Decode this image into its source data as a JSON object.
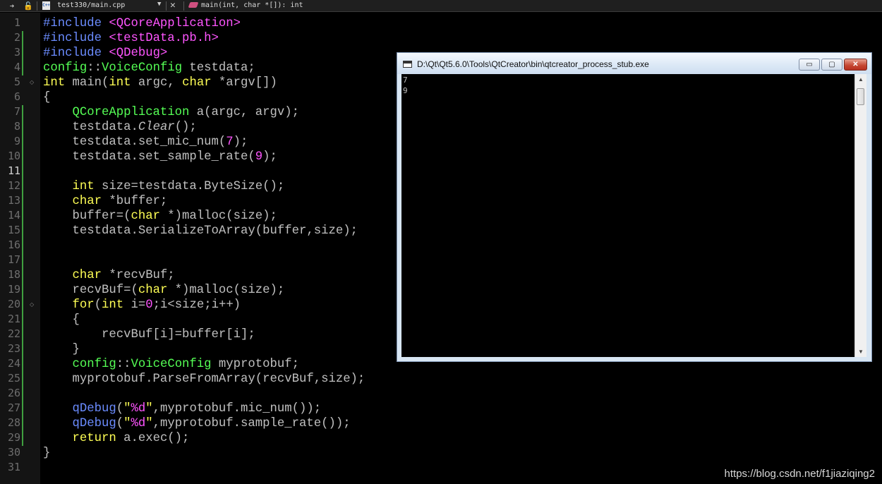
{
  "editor": {
    "document_label": "test330/main.cpp",
    "function_label": "main(int, char *[]): int",
    "current_line": 11,
    "line_numbers": [
      "1",
      "2",
      "3",
      "4",
      "5",
      "6",
      "7",
      "8",
      "9",
      "10",
      "11",
      "12",
      "13",
      "14",
      "15",
      "16",
      "17",
      "18",
      "19",
      "20",
      "21",
      "22",
      "23",
      "24",
      "25",
      "26",
      "27",
      "28",
      "29",
      "30",
      "31"
    ],
    "code": [
      [
        [
          "pp",
          "#include "
        ],
        [
          "inc",
          "<QCoreApplication>"
        ]
      ],
      [
        [
          "pp",
          "#include "
        ],
        [
          "inc",
          "<testData.pb.h>"
        ]
      ],
      [
        [
          "pp",
          "#include "
        ],
        [
          "inc",
          "<QDebug>"
        ]
      ],
      [
        [
          "ty",
          "config"
        ],
        [
          "",
          "::"
        ],
        [
          "ty",
          "VoiceConfig"
        ],
        [
          "",
          " testdata;"
        ]
      ],
      [
        [
          "kw",
          "int"
        ],
        [
          "",
          " main("
        ],
        [
          "kw",
          "int"
        ],
        [
          "",
          " argc, "
        ],
        [
          "kw",
          "char"
        ],
        [
          "",
          " *argv[])"
        ]
      ],
      [
        [
          "",
          "{"
        ]
      ],
      [
        [
          "",
          "    "
        ],
        [
          "ty",
          "QCoreApplication"
        ],
        [
          "",
          " a(argc, argv);"
        ]
      ],
      [
        [
          "",
          "    testdata."
        ],
        [
          "it",
          "Clear"
        ],
        [
          "",
          "();"
        ]
      ],
      [
        [
          "",
          "    testdata.set_mic_num("
        ],
        [
          "num",
          "7"
        ],
        [
          "",
          ");"
        ]
      ],
      [
        [
          "",
          "    testdata.set_sample_rate("
        ],
        [
          "num",
          "9"
        ],
        [
          "",
          ");"
        ]
      ],
      [
        [
          "",
          ""
        ]
      ],
      [
        [
          "",
          "    "
        ],
        [
          "kw",
          "int"
        ],
        [
          "",
          " size=testdata.ByteSize();"
        ]
      ],
      [
        [
          "",
          "    "
        ],
        [
          "kw",
          "char"
        ],
        [
          "",
          " *buffer;"
        ]
      ],
      [
        [
          "",
          "    buffer=("
        ],
        [
          "kw",
          "char"
        ],
        [
          "",
          " *)malloc(size);"
        ]
      ],
      [
        [
          "",
          "    testdata.SerializeToArray(buffer,size);"
        ]
      ],
      [
        [
          "",
          ""
        ]
      ],
      [
        [
          "",
          ""
        ]
      ],
      [
        [
          "",
          "    "
        ],
        [
          "kw",
          "char"
        ],
        [
          "",
          " *recvBuf;"
        ]
      ],
      [
        [
          "",
          "    recvBuf=("
        ],
        [
          "kw",
          "char"
        ],
        [
          "",
          " *)malloc(size);"
        ]
      ],
      [
        [
          "",
          "    "
        ],
        [
          "kw",
          "for"
        ],
        [
          "",
          "("
        ],
        [
          "kw",
          "int"
        ],
        [
          "",
          " i="
        ],
        [
          "num",
          "0"
        ],
        [
          "",
          ";i<size;i++)"
        ]
      ],
      [
        [
          "",
          "    {"
        ]
      ],
      [
        [
          "",
          "        recvBuf[i]=buffer[i];"
        ]
      ],
      [
        [
          "",
          "    }"
        ]
      ],
      [
        [
          "",
          "    "
        ],
        [
          "ty",
          "config"
        ],
        [
          "",
          "::"
        ],
        [
          "ty",
          "VoiceConfig"
        ],
        [
          "",
          " myprotobuf;"
        ]
      ],
      [
        [
          "",
          "    myprotobuf.ParseFromArray(recvBuf,size);"
        ]
      ],
      [
        [
          "",
          ""
        ]
      ],
      [
        [
          "",
          "    "
        ],
        [
          "qd",
          "qDebug"
        ],
        [
          "",
          "("
        ],
        [
          "str",
          "\""
        ],
        [
          "fmt",
          "%d"
        ],
        [
          "str",
          "\""
        ],
        [
          "",
          ",myprotobuf.mic_num());"
        ]
      ],
      [
        [
          "",
          "    "
        ],
        [
          "qd",
          "qDebug"
        ],
        [
          "",
          "("
        ],
        [
          "str",
          "\""
        ],
        [
          "fmt",
          "%d"
        ],
        [
          "str",
          "\""
        ],
        [
          "",
          ",myprotobuf.sample_rate());"
        ]
      ],
      [
        [
          "",
          "    "
        ],
        [
          "kw",
          "return"
        ],
        [
          "",
          " a.exec();"
        ]
      ],
      [
        [
          "",
          "}"
        ]
      ],
      [
        [
          "",
          ""
        ]
      ]
    ],
    "colors": {
      "keyword": "#ffff55",
      "preprocessor": "#6b8cff",
      "include_path": "#ff55ff",
      "type": "#55ff55",
      "number": "#ff55ff",
      "default": "#c0c0c0"
    },
    "icons": {
      "back": "arrow-right-icon",
      "lock": "lock-icon",
      "file": "cpp-file-icon",
      "dropdown": "chevron-down-icon",
      "close": "close-icon",
      "function": "function-icon"
    }
  },
  "console": {
    "title": "D:\\Qt\\Qt5.6.0\\Tools\\QtCreator\\bin\\qtcreator_process_stub.exe",
    "output": [
      "7",
      "9"
    ],
    "buttons": {
      "minimize": "▭",
      "maximize": "▢",
      "close": "✕"
    }
  },
  "watermark": "https://blog.csdn.net/f1jiaziqing2"
}
